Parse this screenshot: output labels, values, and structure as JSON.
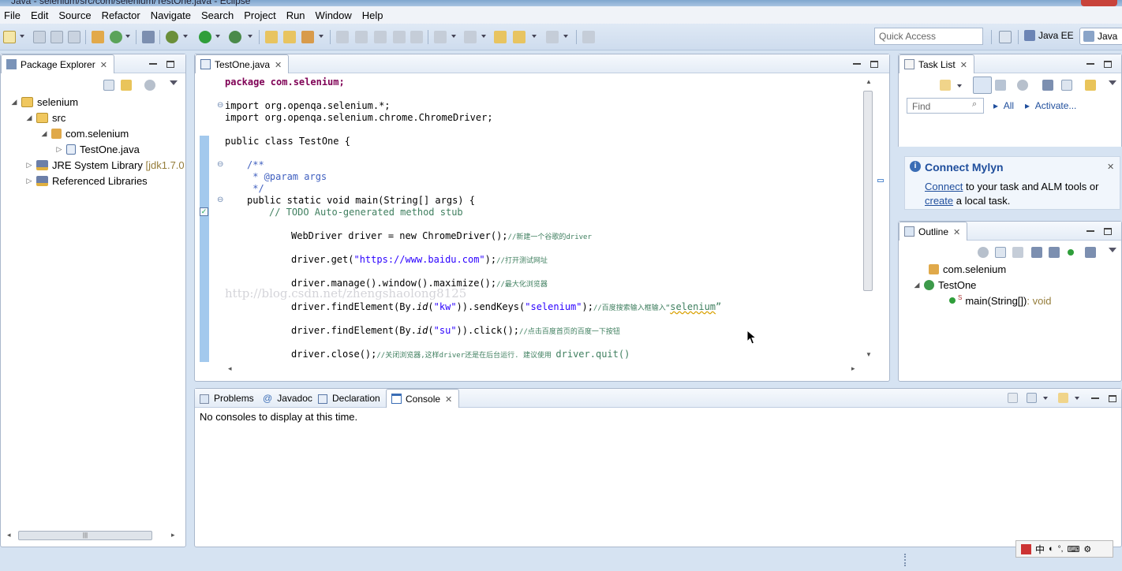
{
  "window": {
    "title": "Java - selenium/src/com/selenium/TestOne.java - Eclipse"
  },
  "menu": [
    "File",
    "Edit",
    "Source",
    "Refactor",
    "Navigate",
    "Search",
    "Project",
    "Run",
    "Window",
    "Help"
  ],
  "toolbar": {
    "quick_access_placeholder": "Quick Access",
    "perspectives": [
      "Java EE",
      "Java"
    ]
  },
  "package_explorer": {
    "title": "Package Explorer",
    "tree": [
      {
        "label": "selenium",
        "expanded": true,
        "icon": "project-folder-icon"
      },
      {
        "label": "src",
        "expanded": true,
        "icon": "source-folder-icon"
      },
      {
        "label": "com.selenium",
        "expanded": true,
        "icon": "package-icon"
      },
      {
        "label": "TestOne.java",
        "expanded": false,
        "icon": "java-file-icon"
      },
      {
        "label": "JRE System Library",
        "suffix": "[jdk1.7.0",
        "expanded": false,
        "icon": "library-icon"
      },
      {
        "label": "Referenced Libraries",
        "expanded": false,
        "icon": "library-icon"
      }
    ]
  },
  "editor": {
    "tab": "TestOne.java",
    "lines": {
      "l1": "package com.selenium;",
      "l2a": "import org.openqa.selenium.*;",
      "l2b": "import org.openqa.selenium.chrome.ChromeDriver;",
      "l3": "public class TestOne {",
      "l4a": "/**",
      "l4b": " * @param args",
      "l4c": " */",
      "l5": "public static void main(String[] args) {",
      "l6": "// TODO Auto-generated method stub",
      "l7": "WebDriver driver = new ChromeDriver();",
      "l7c": "//新建一个谷歌的driver",
      "l8a": "driver.get(",
      "l8s": "\"https://www.baidu.com\"",
      "l8b": ");",
      "l8c": "//打开测试网址",
      "l9": "driver.manage().window().maximize();",
      "l9c": "//最大化浏览器",
      "l10a": "driver.findElement(By.",
      "l10id": "id",
      "l10s": "\"kw\"",
      "l10b": ")).sendKeys(",
      "l10s2": "\"selenium\"",
      "l10e": ");",
      "l10c": "//百度搜索输入框输入“",
      "l10c2": "selenium",
      "l10c3": "”",
      "l11a": "driver.findElement(By.",
      "l11id": "id",
      "l11s": "\"su\"",
      "l11b": ")).click();",
      "l11c": "//点击百度首页的百度一下按钮",
      "l12": "driver.close();",
      "l12c": "//关闭浏览器,这样driver还是在后台运行. 建议使用 ",
      "l12c2": "driver.quit()"
    },
    "watermark": "http://blog.csdn.net/zhengshaolong8125"
  },
  "task_list": {
    "title": "Task List",
    "find_placeholder": "Find",
    "all_label": "All",
    "activate_label": "Activate..."
  },
  "mylyn": {
    "title": "Connect Mylyn",
    "connect_link": "Connect",
    "text1": " to your task and ALM tools or",
    "create_link": "create",
    "text2": " a local task."
  },
  "outline": {
    "title": "Outline",
    "items": [
      {
        "label": "com.selenium",
        "icon": "package-icon"
      },
      {
        "label": "TestOne",
        "icon": "class-icon"
      },
      {
        "label": "main(String[])",
        "type": " : void",
        "icon": "method-icon"
      }
    ]
  },
  "bottom_tabs": [
    "Problems",
    "Javadoc",
    "Declaration",
    "Console"
  ],
  "console": {
    "message": "No consoles to display at this time."
  },
  "ime": {
    "label": "中"
  },
  "colors": {
    "keyword": "#7f0055",
    "string": "#2a00ff",
    "comment": "#3f7f5f",
    "javadoc": "#3f5fbf"
  }
}
